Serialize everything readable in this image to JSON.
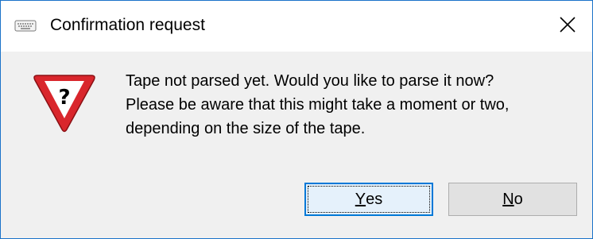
{
  "window": {
    "title": "Confirmation request",
    "app_icon": "keyboard-icon",
    "close_icon": "close-icon",
    "accent_color": "#1a73c9"
  },
  "dialog": {
    "icon": "warning-question-icon",
    "message_lines": [
      "Tape not parsed yet. Would you like to parse it now?",
      "Please be aware that this might take a moment or two,",
      "depending on the size of the tape."
    ]
  },
  "buttons": {
    "yes": {
      "mnemonic": "Y",
      "rest": "es",
      "default": true
    },
    "no": {
      "mnemonic": "N",
      "rest": "o"
    }
  }
}
